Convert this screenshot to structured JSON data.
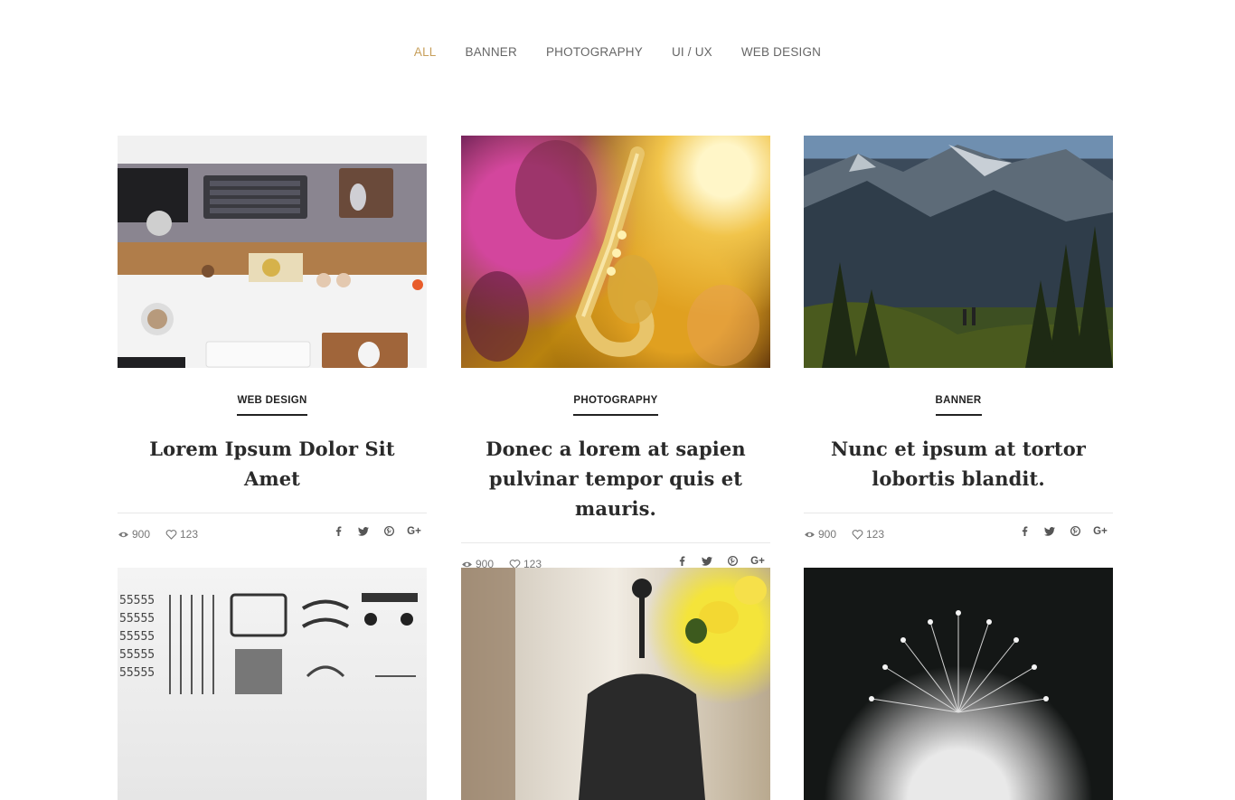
{
  "filters": [
    {
      "label": "ALL",
      "active": true
    },
    {
      "label": "BANNER",
      "active": false
    },
    {
      "label": "PHOTOGRAPHY",
      "active": false
    },
    {
      "label": "UI / UX",
      "active": false
    },
    {
      "label": "WEB DESIGN",
      "active": false
    }
  ],
  "colors": {
    "accent": "#c79f5b",
    "text": "#222222",
    "muted": "#777777"
  },
  "icons": {
    "views": "eye-icon",
    "likes": "heart-icon",
    "share": [
      "facebook-icon",
      "twitter-icon",
      "pinterest-icon",
      "google-plus-icon"
    ]
  },
  "posts": [
    {
      "category": "WEB DESIGN",
      "title": "Lorem Ipsum Dolor Sit Amet",
      "views": "900",
      "likes": "123",
      "image": "desk workspace"
    },
    {
      "category": "PHOTOGRAPHY",
      "title": "Donec a lorem at sapien pulvinar tempor quis et mauris.",
      "views": "900",
      "likes": "123",
      "image": "saxophone concert"
    },
    {
      "category": "BANNER",
      "title": "Nunc et ipsum at tortor lobortis blandit.",
      "views": "900",
      "likes": "123",
      "image": "mountain landscape"
    },
    {
      "image": "typewriter parts"
    },
    {
      "image": "teapot with flowers"
    },
    {
      "image": "dandelion"
    }
  ]
}
